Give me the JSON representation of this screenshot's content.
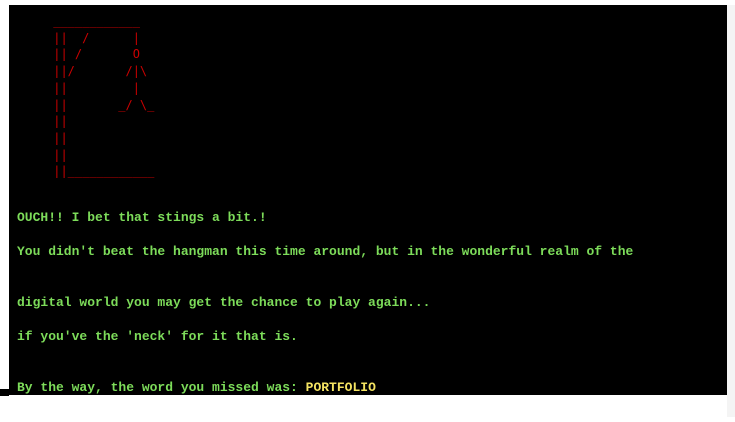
{
  "colors": {
    "background": "#000000",
    "message_text": "#7ddc5a",
    "gallows": "#cc0000",
    "missed_word": "#f5e462"
  },
  "gallows_art": [
    " ____________",
    " ||  /      |",
    " || /       O",
    " ||/       /|\\",
    " ||         |",
    " ||       _/ \\_",
    " ||",
    " ||",
    " ||",
    " ||____________"
  ],
  "messages": {
    "ouch": "OUCH!! I bet that stings a bit.!",
    "line1": "You didn't beat the hangman this time around, but in the wonderful realm of the",
    "line2": "digital world you may get the chance to play again...",
    "line3": "if you've the 'neck' for it that is.",
    "missed_prefix": "By the way, the word you missed was: ",
    "missed_word": "PORTFOLIO"
  }
}
